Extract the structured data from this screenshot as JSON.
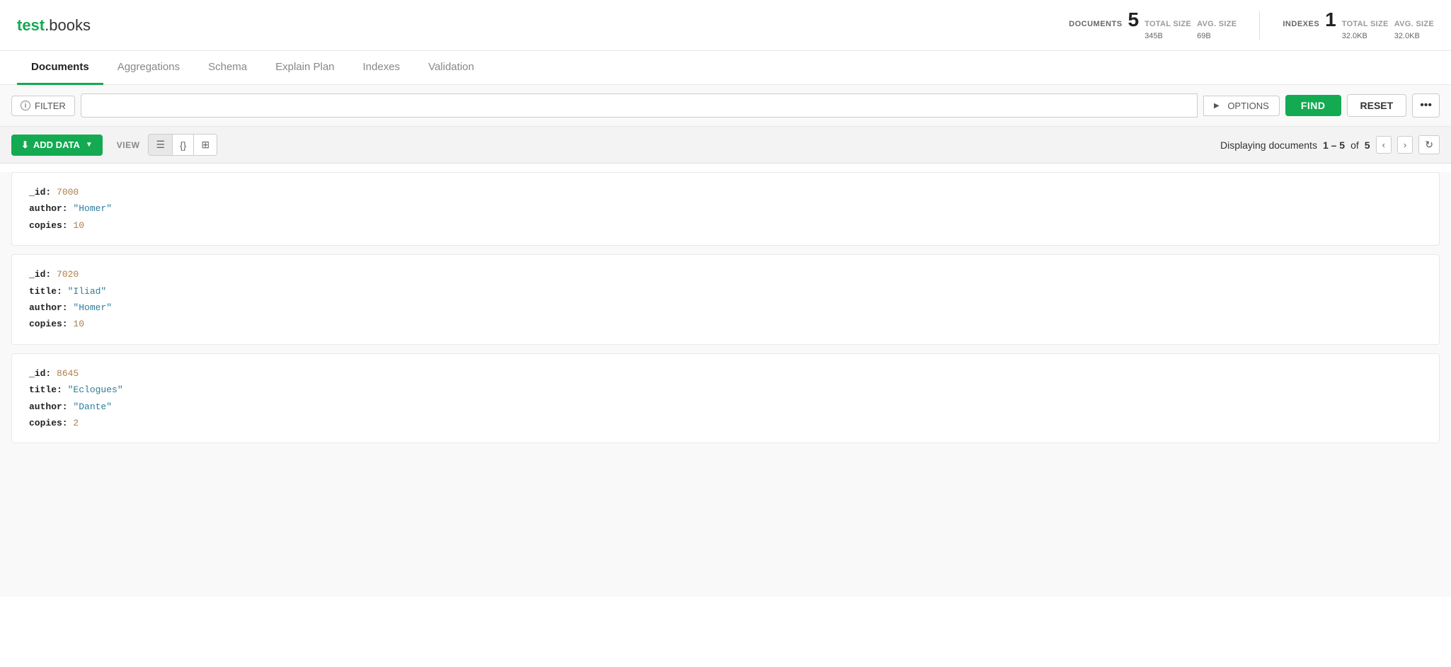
{
  "app": {
    "title_test": "test",
    "title_sep": ".",
    "title_books": "books"
  },
  "header": {
    "documents_label": "DOCUMENTS",
    "documents_count": "5",
    "documents_total_size_label": "TOTAL SIZE",
    "documents_total_size": "345B",
    "documents_avg_size_label": "AVG. SIZE",
    "documents_avg_size": "69B",
    "indexes_label": "INDEXES",
    "indexes_count": "1",
    "indexes_total_size_label": "TOTAL SIZE",
    "indexes_total_size": "32.0KB",
    "indexes_avg_size_label": "AVG. SIZE",
    "indexes_avg_size": "32.0KB"
  },
  "tabs": [
    {
      "id": "documents",
      "label": "Documents",
      "active": true
    },
    {
      "id": "aggregations",
      "label": "Aggregations",
      "active": false
    },
    {
      "id": "schema",
      "label": "Schema",
      "active": false
    },
    {
      "id": "explain-plan",
      "label": "Explain Plan",
      "active": false
    },
    {
      "id": "indexes",
      "label": "Indexes",
      "active": false
    },
    {
      "id": "validation",
      "label": "Validation",
      "active": false
    }
  ],
  "filter": {
    "filter_label": "FILTER",
    "options_label": "OPTIONS",
    "find_label": "FIND",
    "reset_label": "RESET",
    "more_label": "•••"
  },
  "toolbar": {
    "add_data_label": "ADD DATA",
    "view_label": "VIEW",
    "pagination_prefix": "Displaying documents ",
    "pagination_range": "1 – 5",
    "pagination_of": "of",
    "pagination_total": "5"
  },
  "documents": [
    {
      "id": "doc1",
      "fields": [
        {
          "key": "_id:",
          "value": "7000",
          "type": "num"
        },
        {
          "key": "author:",
          "value": "\"Homer\"",
          "type": "str"
        },
        {
          "key": "copies:",
          "value": "10",
          "type": "num"
        }
      ]
    },
    {
      "id": "doc2",
      "fields": [
        {
          "key": "_id:",
          "value": "7020",
          "type": "num"
        },
        {
          "key": "title:",
          "value": "\"Iliad\"",
          "type": "str"
        },
        {
          "key": "author:",
          "value": "\"Homer\"",
          "type": "str"
        },
        {
          "key": "copies:",
          "value": "10",
          "type": "num"
        }
      ]
    },
    {
      "id": "doc3",
      "fields": [
        {
          "key": "_id:",
          "value": "8645",
          "type": "num"
        },
        {
          "key": "title:",
          "value": "\"Eclogues\"",
          "type": "str"
        },
        {
          "key": "author:",
          "value": "\"Dante\"",
          "type": "str"
        },
        {
          "key": "copies:",
          "value": "2",
          "type": "num"
        }
      ]
    }
  ]
}
